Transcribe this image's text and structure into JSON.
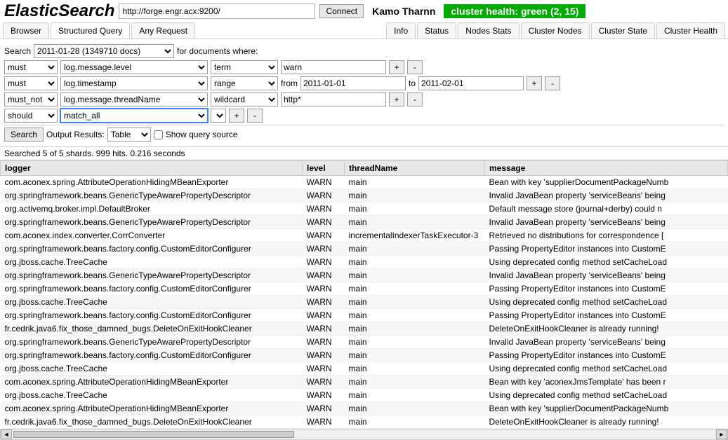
{
  "header": {
    "logo": "ElasticSearch",
    "url": "http://forge.engr.acx:9200/",
    "connect": "Connect",
    "username": "Kamo Tharnn",
    "health": "cluster health: green (2, 15)"
  },
  "tabs": {
    "left": [
      "Browser",
      "Structured Query",
      "Any Request"
    ],
    "right": [
      "Info",
      "Status",
      "Nodes Stats",
      "Cluster Nodes",
      "Cluster State",
      "Cluster Health"
    ]
  },
  "search": {
    "label": "Search",
    "index": "2011-01-28 (1349710 docs)",
    "forDocs": "for documents where:"
  },
  "clauses": [
    {
      "bool": "must",
      "field": "log.message.level",
      "op": "term",
      "val1": "warn"
    },
    {
      "bool": "must",
      "field": "log.timestamp",
      "op": "range",
      "from": "from",
      "val1": "2011-01-01",
      "to": "to",
      "val2": "2011-02-01"
    },
    {
      "bool": "must_not",
      "field": "log.message.threadName",
      "op": "wildcard",
      "val1": "http*"
    },
    {
      "bool": "should",
      "field": "match_all"
    }
  ],
  "controls": {
    "search": "Search",
    "outputLabel": "Output Results:",
    "outputFormat": "Table",
    "showSource": "Show query source"
  },
  "resultsInfo": "Searched 5 of 5 shards. 999 hits. 0.216 seconds",
  "columns": [
    "logger",
    "level",
    "threadName",
    "message"
  ],
  "rows": [
    {
      "logger": "com.aconex.spring.AttributeOperationHidingMBeanExporter",
      "level": "WARN",
      "thread": "main",
      "msg": "Bean with key 'supplierDocumentPackageNumb"
    },
    {
      "logger": "org.springframework.beans.GenericTypeAwarePropertyDescriptor",
      "level": "WARN",
      "thread": "main",
      "msg": "Invalid JavaBean property 'serviceBeans' being"
    },
    {
      "logger": "org.activemq.broker.impl.DefaultBroker",
      "level": "WARN",
      "thread": "main",
      "msg": "Default message store (journal+derby) could n"
    },
    {
      "logger": "org.springframework.beans.GenericTypeAwarePropertyDescriptor",
      "level": "WARN",
      "thread": "main",
      "msg": "Invalid JavaBean property 'serviceBeans' being"
    },
    {
      "logger": "com.aconex.index.converter.CorrConverter",
      "level": "WARN",
      "thread": "incrementalIndexerTaskExecutor-3",
      "msg": "Retrieved no distributions for correspondence ["
    },
    {
      "logger": "org.springframework.beans.factory.config.CustomEditorConfigurer",
      "level": "WARN",
      "thread": "main",
      "msg": "Passing PropertyEditor instances into CustomE"
    },
    {
      "logger": "org.jboss.cache.TreeCache",
      "level": "WARN",
      "thread": "main",
      "msg": "Using deprecated config method setCacheLoad"
    },
    {
      "logger": "org.springframework.beans.GenericTypeAwarePropertyDescriptor",
      "level": "WARN",
      "thread": "main",
      "msg": "Invalid JavaBean property 'serviceBeans' being"
    },
    {
      "logger": "org.springframework.beans.factory.config.CustomEditorConfigurer",
      "level": "WARN",
      "thread": "main",
      "msg": "Passing PropertyEditor instances into CustomE"
    },
    {
      "logger": "org.jboss.cache.TreeCache",
      "level": "WARN",
      "thread": "main",
      "msg": "Using deprecated config method setCacheLoad"
    },
    {
      "logger": "org.springframework.beans.factory.config.CustomEditorConfigurer",
      "level": "WARN",
      "thread": "main",
      "msg": "Passing PropertyEditor instances into CustomE"
    },
    {
      "logger": "fr.cedrik.java6.fix_those_damned_bugs.DeleteOnExitHookCleaner",
      "level": "WARN",
      "thread": "main",
      "msg": "DeleteOnExitHookCleaner is already running!"
    },
    {
      "logger": "org.springframework.beans.GenericTypeAwarePropertyDescriptor",
      "level": "WARN",
      "thread": "main",
      "msg": "Invalid JavaBean property 'serviceBeans' being"
    },
    {
      "logger": "org.springframework.beans.factory.config.CustomEditorConfigurer",
      "level": "WARN",
      "thread": "main",
      "msg": "Passing PropertyEditor instances into CustomE"
    },
    {
      "logger": "org.jboss.cache.TreeCache",
      "level": "WARN",
      "thread": "main",
      "msg": "Using deprecated config method setCacheLoad"
    },
    {
      "logger": "com.aconex.spring.AttributeOperationHidingMBeanExporter",
      "level": "WARN",
      "thread": "main",
      "msg": "Bean with key 'aconexJmsTemplate' has been r"
    },
    {
      "logger": "org.jboss.cache.TreeCache",
      "level": "WARN",
      "thread": "main",
      "msg": "Using deprecated config method setCacheLoad"
    },
    {
      "logger": "com.aconex.spring.AttributeOperationHidingMBeanExporter",
      "level": "WARN",
      "thread": "main",
      "msg": "Bean with key 'supplierDocumentPackageNumb"
    },
    {
      "logger": "fr.cedrik.java6.fix_those_damned_bugs.DeleteOnExitHookCleaner",
      "level": "WARN",
      "thread": "main",
      "msg": "DeleteOnExitHookCleaner is already running!"
    }
  ]
}
